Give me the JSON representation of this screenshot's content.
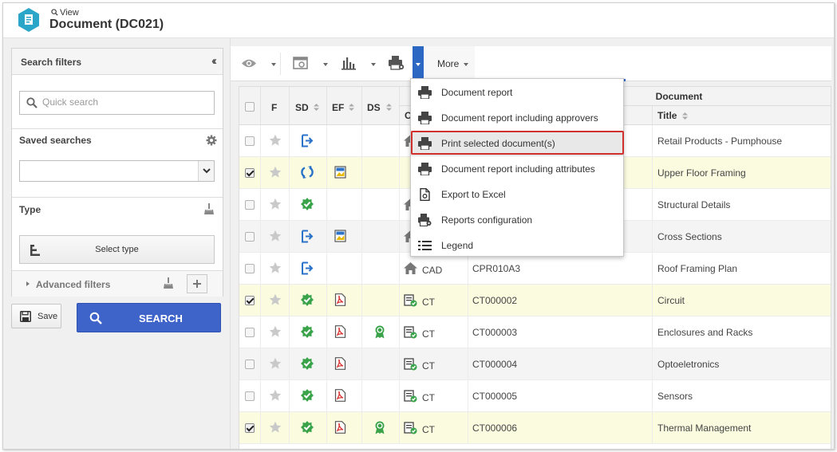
{
  "header": {
    "breadcrumb": "View",
    "title": "Document (DC021)",
    "app_icon_color": "#2ba6c9"
  },
  "sidebar": {
    "title": "Search filters",
    "quick_search_placeholder": "Quick search",
    "saved_searches_label": "Saved searches",
    "saved_search_value": "",
    "type_label": "Type",
    "select_type_label": "Select type",
    "advanced_filters_label": "Advanced filters",
    "save_label": "Save",
    "search_label": "SEARCH"
  },
  "toolbar": {
    "more_label": "More",
    "accent_color": "#2d67c4"
  },
  "grid": {
    "columns": {
      "f": "F",
      "sd": "SD",
      "ef": "EF",
      "ds": "DS",
      "category_partial": "C",
      "document_group": "Document",
      "title": "Title"
    },
    "rows": [
      {
        "checked": false,
        "sd": "arrow",
        "ef": "",
        "ds": "",
        "cat_icon": "house",
        "category": "",
        "code": "",
        "title": "Retail Products - Pumphouse"
      },
      {
        "checked": true,
        "sd": "sync",
        "ef": "image",
        "ds": "",
        "cat_icon": "",
        "category": "",
        "code": "",
        "title": "Upper Floor Framing"
      },
      {
        "checked": false,
        "sd": "check",
        "ef": "",
        "ds": "",
        "cat_icon": "house",
        "category": "",
        "code": "",
        "title": "Structural Details"
      },
      {
        "checked": false,
        "sd": "arrow",
        "ef": "image",
        "ds": "",
        "cat_icon": "house",
        "category": "",
        "code": "",
        "title": "Cross Sections"
      },
      {
        "checked": false,
        "sd": "arrow",
        "ef": "",
        "ds": "",
        "cat_icon": "house",
        "category": "CAD",
        "code": "CPR010A3",
        "title": "Roof Framing Plan"
      },
      {
        "checked": true,
        "sd": "check",
        "ef": "pdf",
        "ds": "",
        "cat_icon": "doc",
        "category": "CT",
        "code": "CT000002",
        "title": "Circuit"
      },
      {
        "checked": false,
        "sd": "check",
        "ef": "pdf",
        "ds": "medal",
        "cat_icon": "doc",
        "category": "CT",
        "code": "CT000003",
        "title": "Enclosures and Racks"
      },
      {
        "checked": false,
        "sd": "check",
        "ef": "pdf",
        "ds": "",
        "cat_icon": "doc",
        "category": "CT",
        "code": "CT000004",
        "title": "Optoeletronics"
      },
      {
        "checked": false,
        "sd": "check",
        "ef": "pdf",
        "ds": "",
        "cat_icon": "doc",
        "category": "CT",
        "code": "CT000005",
        "title": "Sensors"
      },
      {
        "checked": true,
        "sd": "check",
        "ef": "pdf",
        "ds": "medal",
        "cat_icon": "doc",
        "category": "CT",
        "code": "CT000006",
        "title": "Thermal Management"
      }
    ]
  },
  "menu": {
    "items": [
      {
        "label": "Document report",
        "icon": "printer-icon"
      },
      {
        "label": "Document report including approvers",
        "icon": "printer-icon"
      },
      {
        "label": "Print selected document(s)",
        "icon": "printer-icon",
        "highlighted": true
      },
      {
        "label": "Document report including attributes",
        "icon": "printer-icon"
      },
      {
        "label": "Export to Excel",
        "icon": "excel-file-icon"
      },
      {
        "label": "Reports configuration",
        "icon": "printer-gear-icon"
      },
      {
        "label": "Legend",
        "icon": "list-icon"
      }
    ]
  },
  "colors": {
    "search_button": "#3f64c9",
    "highlight_border": "#d0312d",
    "selected_row": "#fbfbe0",
    "status_green": "#3aa34a",
    "status_blue": "#2a73c9"
  }
}
